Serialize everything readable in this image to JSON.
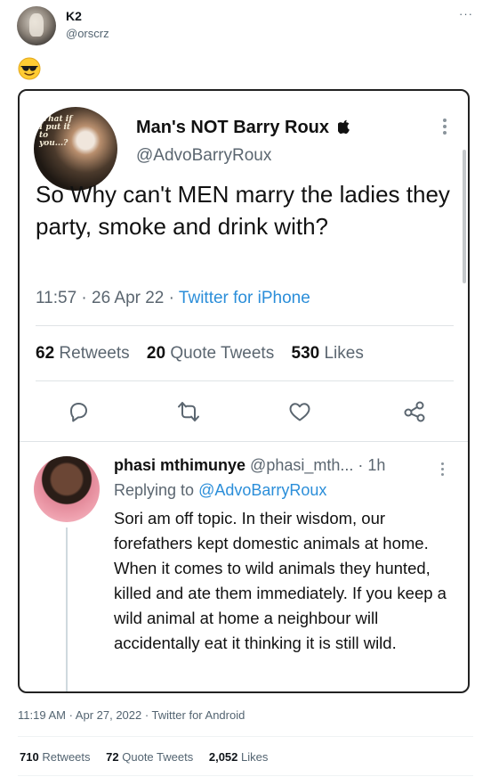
{
  "author": {
    "name": "K2",
    "handle": "@orscrz"
  },
  "more_label": "···",
  "emoji_icon": "smiling-face-with-sunglasses-icon",
  "screenshot": {
    "quoted": {
      "avatar_note": "What if I put it to you...?",
      "name": "Man's NOT Barry Roux",
      "name_icon": "apple-logo-icon",
      "handle": "@AdvoBarryRoux",
      "text": "So Why can't MEN marry the ladies they party, smoke and drink with?",
      "time": "11:57",
      "date": "26 Apr 22",
      "app": "Twitter for iPhone",
      "dot": "·",
      "stats": {
        "retweets_count": "62",
        "retweets_label": "Retweets",
        "quotes_count": "20",
        "quotes_label": "Quote Tweets",
        "likes_count": "530",
        "likes_label": "Likes"
      },
      "actions": [
        "reply-icon",
        "retweet-icon",
        "like-icon",
        "share-icon"
      ]
    },
    "reply": {
      "name": "phasi mthimunye",
      "handle": "@phasi_mth...",
      "age": "· 1h",
      "replying_prefix": "Replying to",
      "replying_mention": "@AdvoBarryRoux",
      "text": "Sori am off topic. In their wisdom, our forefathers kept domestic animals at home. When it comes to wild animals they hunted, killed and ate them immediately. If you keep a wild animal at home a neighbour will accidentally eat it thinking it is still wild."
    }
  },
  "post": {
    "timestamp": "11:19 AM · Apr 27, 2022 · Twitter for Android",
    "stats": {
      "retweets_count": "710",
      "retweets_label": "Retweets",
      "quotes_count": "72",
      "quotes_label": "Quote Tweets",
      "likes_count": "2,052",
      "likes_label": "Likes"
    }
  },
  "colors": {
    "link": "#2b8ed9",
    "muted": "#536471",
    "text": "#0f1419"
  }
}
